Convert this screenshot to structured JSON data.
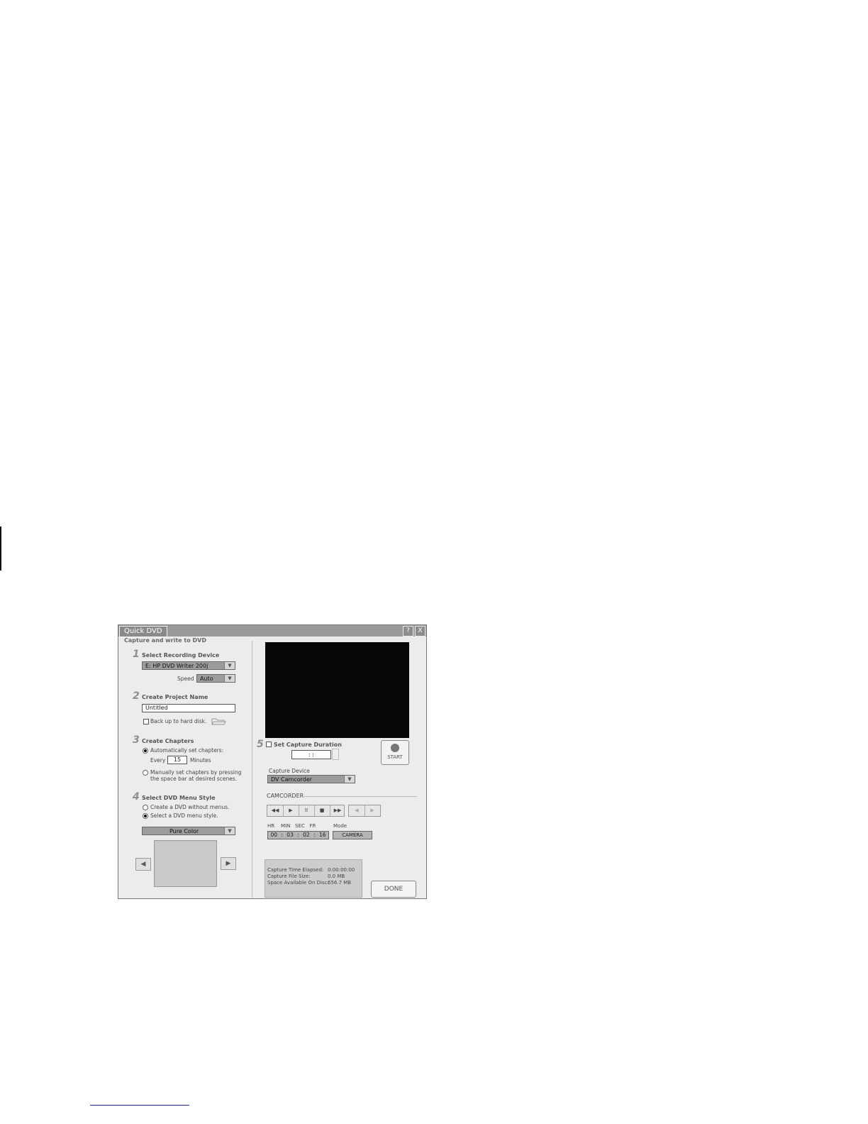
{
  "window": {
    "title": "Quick DVD",
    "subtitle": "Capture and write to DVD",
    "help_label": "?",
    "close_label": "X"
  },
  "step1": {
    "number": "1",
    "heading": "Select Recording Device",
    "device": "E: HP DVD Writer 200j",
    "speed_label": "Speed",
    "speed_value": "Auto"
  },
  "step2": {
    "number": "2",
    "heading": "Create Project Name",
    "project_name": "Untitled",
    "backup_label": "Back up to hard disk."
  },
  "step3": {
    "number": "3",
    "heading": "Create Chapters",
    "auto_label": "Automatically set chapters:",
    "every_label": "Every",
    "every_value": "15",
    "minutes_label": "Minutes",
    "manual_line1": "Manually set chapters by pressing",
    "manual_line2": "the space bar at desired scenes."
  },
  "step4": {
    "number": "4",
    "heading": "Select DVD Menu Style",
    "no_menu_label": "Create a DVD without menus.",
    "with_menu_label": "Select a DVD menu style.",
    "menu_style": "Pure Color"
  },
  "step5": {
    "number": "5",
    "duration_label": "Set Capture Duration",
    "duration_value": ":     :",
    "start_label": "START"
  },
  "capture": {
    "device_label": "Capture Device",
    "device_value": "DV Camcorder",
    "section_label": "CAMCORDER",
    "timecode_headers": "HR    MIN   SEC   FR",
    "timecode_value": "00 : 03 : 02 : 16",
    "mode_label": "Mode",
    "mode_value": "CAMERA"
  },
  "transport": {
    "rewind": "◀◀",
    "play": "▶",
    "pause": "II",
    "stop": "■",
    "fast_forward": "▶▶",
    "prev": "◀",
    "next": "▶"
  },
  "stats": {
    "elapsed_label": "Capture Time Elapsed:",
    "elapsed_value": "0:00:00:00",
    "size_label": "Capture File Size:",
    "size_value": "0.0 MB",
    "space_label": "Space Available On Disc:",
    "space_value": "656.7 MB"
  },
  "done_label": "DONE"
}
